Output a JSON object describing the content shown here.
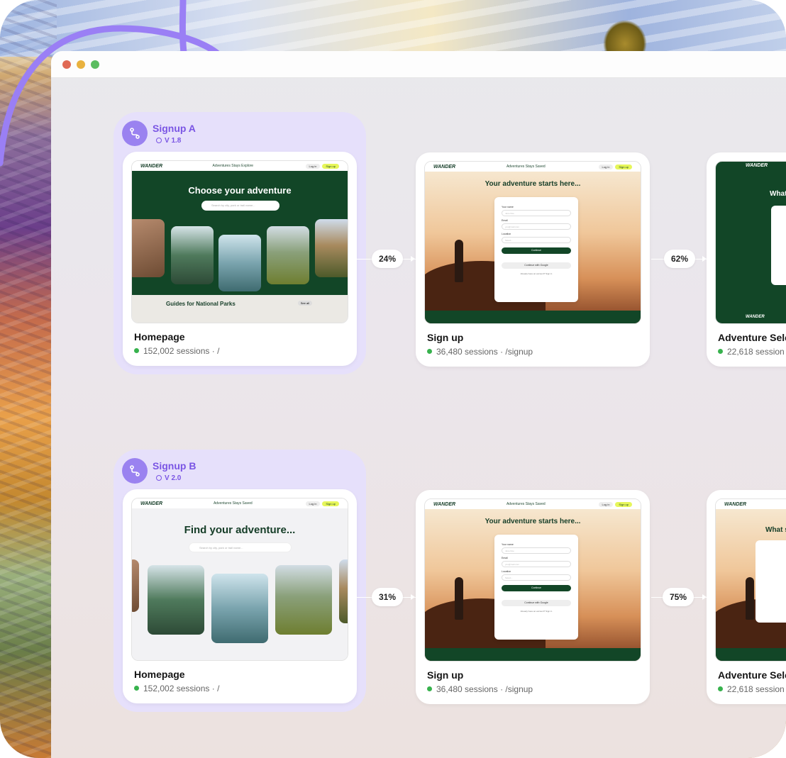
{
  "variants": [
    {
      "name": "Signup A",
      "version": "V 1.8",
      "steps": [
        {
          "page": "Homepage",
          "sessions": "152,002 sessions",
          "path": "/",
          "mock": {
            "logo": "WANDER",
            "links": "Adventures  Stays  Explore",
            "login": "Log in",
            "signup": "Sign up",
            "headline": "Choose your adventure",
            "search_placeholder": "Search by city, park or trail name...",
            "guides_title": "Guides for National Parks",
            "guides_link": "See all"
          }
        },
        {
          "page": "Sign up",
          "sessions": "36,480 sessions",
          "path": "/signup",
          "mock": {
            "logo": "WANDER",
            "links": "Adventures  Stays  Saved",
            "login": "Log in",
            "signup": "Sign up",
            "headline": "Your adventure starts here...",
            "name_label": "Your name",
            "name_placeholder": "Jane Doe",
            "email_label": "Email",
            "email_placeholder": "you@mail.com",
            "location_label": "Location",
            "location_placeholder": "Select...",
            "continue": "Continue",
            "google": "Continue with Google",
            "note": "Already have an account? Sign in"
          }
        },
        {
          "page": "Adventure Sele",
          "sessions": "22,618 session",
          "path": "",
          "mock": {
            "logo": "WANDER",
            "headline": "What"
          }
        }
      ],
      "conversions": [
        "24%",
        "62%"
      ]
    },
    {
      "name": "Signup B",
      "version": "V 2.0",
      "steps": [
        {
          "page": "Homepage",
          "sessions": "152,002 sessions",
          "path": "/",
          "mock": {
            "logo": "WANDER",
            "links": "Adventures  Stays  Saved",
            "login": "Log in",
            "signup": "Sign up",
            "headline": "Find your adventure...",
            "search_placeholder": "Search by city, park or trail name..."
          }
        },
        {
          "page": "Sign up",
          "sessions": "36,480 sessions",
          "path": "/signup",
          "mock": {
            "logo": "WANDER",
            "links": "Adventures  Stays  Saved",
            "login": "Log in",
            "signup": "Sign up",
            "headline": "Your adventure starts here...",
            "name_label": "Your name",
            "name_placeholder": "Jane Doe",
            "email_label": "Email",
            "email_placeholder": "you@mail.com",
            "location_label": "Location",
            "location_placeholder": "Select...",
            "continue": "Continue",
            "google": "Continue with Google",
            "note": "Already have an account? Sign in"
          }
        },
        {
          "page": "Adventure Sele",
          "sessions": "22,618 session",
          "path": "",
          "mock": {
            "logo": "WANDER",
            "headline": "What so"
          }
        }
      ],
      "conversions": [
        "31%",
        "75%"
      ]
    }
  ],
  "colors": {
    "accent": "#7a55e4",
    "variant_bg": "#e6e0fb",
    "forest": "#124627",
    "lime": "#e6f65a",
    "status_green": "#37b24d"
  },
  "icons": {
    "variant": "route-icon",
    "version": "clock-icon",
    "window_controls": [
      "close-dot",
      "minimize-dot",
      "maximize-dot"
    ]
  }
}
